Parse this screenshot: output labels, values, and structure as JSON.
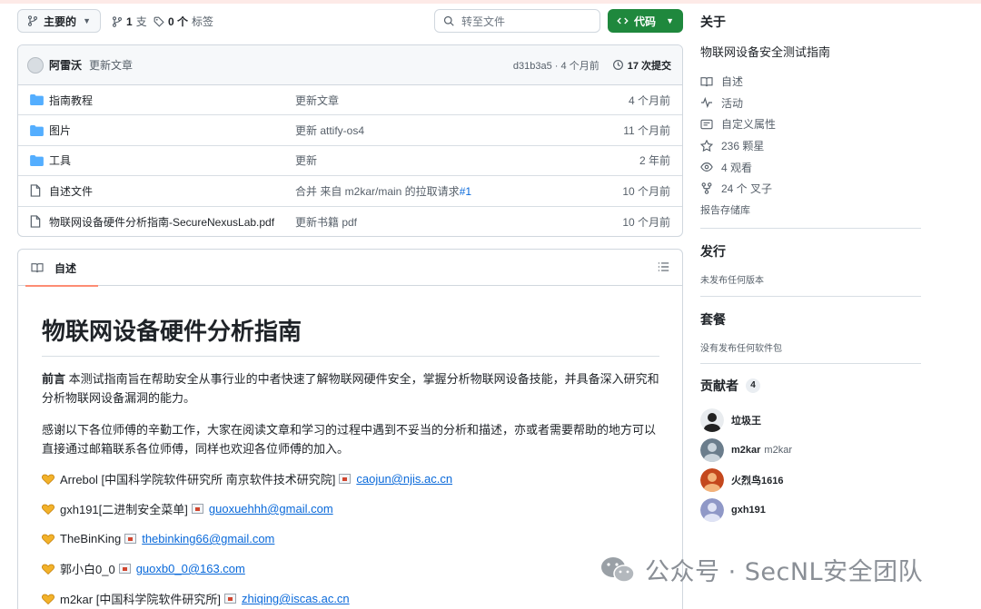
{
  "toolbar": {
    "branch_label": "主要的",
    "branches_count": "1",
    "branches_label": "支",
    "tags_count": "0 个",
    "tags_label": "标签",
    "search_placeholder": "转至文件",
    "code_label": "代码"
  },
  "commit": {
    "author": "阿雷沃",
    "message": "更新文章",
    "hash_time": "d31b3a5 · 4 个月前",
    "count": "17 次提交"
  },
  "files": [
    {
      "type": "folder",
      "name": "指南教程",
      "message": "更新文章",
      "date": "4 个月前"
    },
    {
      "type": "folder",
      "name": "图片",
      "message": "更新 attify-os4",
      "date": "11 个月前"
    },
    {
      "type": "folder",
      "name": "工具",
      "message": "更新",
      "date": "2 年前"
    },
    {
      "type": "file",
      "name": "自述文件",
      "message": "合并 来自 m2kar/main 的拉取请求",
      "link": "#1",
      "date": "10 个月前"
    },
    {
      "type": "file",
      "name": "物联网设备硬件分析指南-SecureNexusLab.pdf",
      "message": "更新书籍 pdf",
      "date": "10 个月前"
    }
  ],
  "readme": {
    "tab_label": "自述",
    "title": "物联网设备硬件分析指南",
    "intro_bold": "前言",
    "intro_text": " 本测试指南旨在帮助安全从事行业的中者快速了解物联网硬件安全，掌握分析物联网设备技能，并具备深入研究和分析物联网设备漏洞的能力。",
    "thanks_text": "感谢以下各位师傅的辛勤工作，大家在阅读文章和学习的过程中遇到不妥当的分析和描述，亦或者需要帮助的地方可以直接通过邮箱联系各位师傅，同样也欢迎各位师傅的加入。",
    "contributors": [
      {
        "text": "Arrebol [中国科学院软件研究所 南京软件技术研究院]",
        "email": "caojun@njis.ac.cn"
      },
      {
        "text": "gxh191[二进制安全菜单]",
        "email": "guoxuehhh@gmail.com"
      },
      {
        "text": "TheBinKing",
        "email": "thebinking66@gmail.com"
      },
      {
        "text": "郭小白0_0",
        "email": "guoxb0_0@163.com"
      },
      {
        "text": "m2kar [中国科学院软件研究所]",
        "email": "zhiqing@iscas.ac.cn"
      }
    ]
  },
  "about": {
    "heading": "关于",
    "description": "物联网设备安全测试指南",
    "items": [
      {
        "icon": "book-icon",
        "label": "自述"
      },
      {
        "icon": "pulse-icon",
        "label": "活动"
      },
      {
        "icon": "note-icon",
        "label": "自定义属性"
      },
      {
        "icon": "star-icon",
        "label": "236 颗星"
      },
      {
        "icon": "eye-icon",
        "label": "4 观看"
      },
      {
        "icon": "fork-icon",
        "label": "24 个 叉子"
      }
    ],
    "report": "报告存储库"
  },
  "releases": {
    "heading": "发行",
    "note": "未发布任何版本"
  },
  "packages": {
    "heading": "套餐",
    "note": "没有发布任何软件包"
  },
  "contributors_side": {
    "heading": "贡献者",
    "count": "4",
    "list": [
      {
        "name": "垃圾王",
        "sub": ""
      },
      {
        "name": "m2kar",
        "sub": "m2kar"
      },
      {
        "name": "火烈鸟1616",
        "sub": ""
      },
      {
        "name": "gxh191",
        "sub": ""
      }
    ]
  },
  "watermark": "公众号 · SecNL安全团队",
  "colors": {
    "accent_green": "#1f883d",
    "link_blue": "#0969da",
    "folder_blue": "#54aeff",
    "tab_underline": "#fd8c73"
  }
}
